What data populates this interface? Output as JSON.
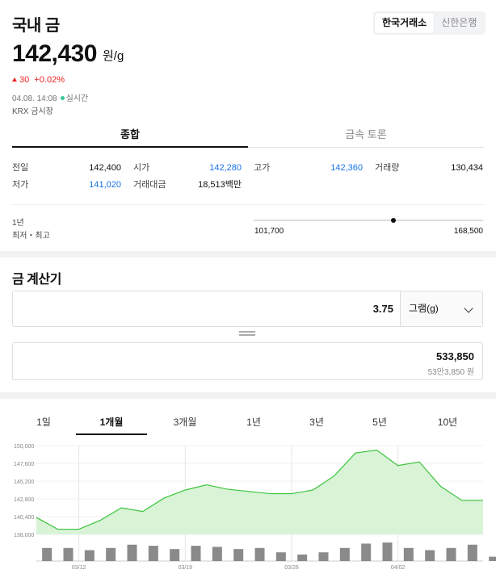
{
  "header": {
    "title": "국내 금",
    "sources": [
      "한국거래소",
      "신한은행"
    ],
    "active_source": 0,
    "price": "142,430",
    "price_unit": "원/g",
    "change": "30",
    "change_pct": "+0.02%",
    "timestamp": "04.08. 14:08",
    "realtime_label": "실시간",
    "market": "KRX 금시장"
  },
  "tabs": [
    "종합",
    "금속 토론"
  ],
  "stats": {
    "prev_close_label": "전일",
    "prev_close": "142,400",
    "open_label": "시가",
    "open": "142,280",
    "high_label": "고가",
    "high": "142,360",
    "volume_label": "거래량",
    "volume": "130,434",
    "low_label": "저가",
    "low": "141,020",
    "value_label": "거래대금",
    "value": "18,513백만"
  },
  "range": {
    "period": "1년",
    "label": "최저・최고",
    "low": "101,700",
    "high": "168,500",
    "current_fraction": 0.61
  },
  "calculator": {
    "title": "금 계산기",
    "quantity": "3.75",
    "unit": "그램(g)",
    "result": "533,850",
    "result_korean": "53만3,850 원"
  },
  "period_tabs": [
    "1일",
    "1개월",
    "3개월",
    "1년",
    "3년",
    "5년",
    "10년"
  ],
  "active_period": 1,
  "colors": {
    "up": "#e22222",
    "blue": "#1a73e8",
    "line": "#3cc43c",
    "fill": "#d8f3d6",
    "bar": "#8a8a8a"
  },
  "chart_data": {
    "type": "area",
    "y_ticks": [
      "150,000",
      "147,600",
      "145,200",
      "142,800",
      "140,400",
      "138,000"
    ],
    "ylim": [
      138000,
      150000
    ],
    "x_ticks": [
      {
        "label": "03/12",
        "index": 2
      },
      {
        "label": "03/19",
        "index": 7
      },
      {
        "label": "03/26",
        "index": 12
      },
      {
        "label": "04/02",
        "index": 17
      }
    ],
    "values": [
      140300,
      138700,
      138700,
      139900,
      141600,
      141100,
      142900,
      144000,
      144700,
      144100,
      143800,
      143500,
      143500,
      144000,
      145900,
      149000,
      149400,
      147300,
      147800,
      144500,
      142600,
      142600
    ],
    "volume": [
      0.6,
      0.6,
      0.5,
      0.6,
      0.75,
      0.7,
      0.55,
      0.7,
      0.65,
      0.55,
      0.6,
      0.4,
      0.3,
      0.4,
      0.6,
      0.8,
      0.85,
      0.6,
      0.5,
      0.6,
      0.75,
      0.2
    ]
  }
}
